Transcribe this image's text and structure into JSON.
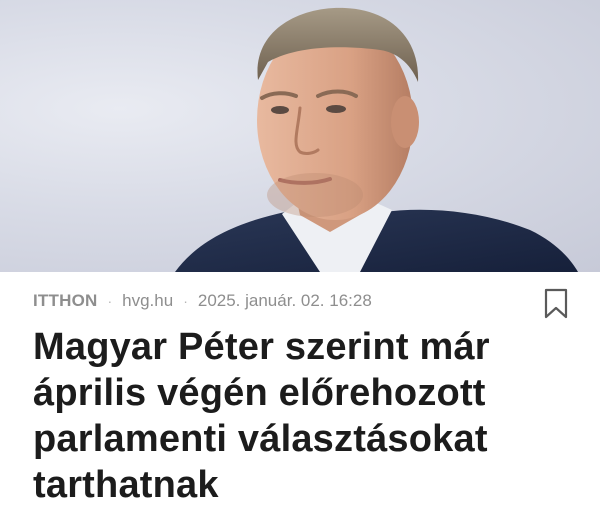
{
  "article": {
    "category": "ITTHON",
    "source": "hvg.hu",
    "date": "2025. január. 02. 16:28",
    "title": "Magyar Péter szerint már április végén előrehozott parlamenti választásokat tarthatnak",
    "bookmark_icon": "bookmark-icon",
    "separator": "·"
  },
  "colors": {
    "meta_text": "#8e8e8e",
    "title_text": "#1c1c1c",
    "jacket": "#1f2a44"
  }
}
